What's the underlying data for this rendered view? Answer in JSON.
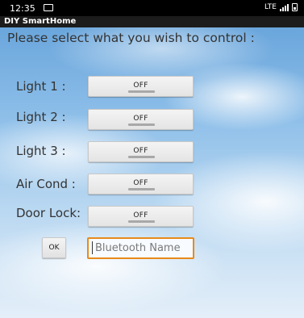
{
  "status_bar": {
    "time": "12:35",
    "network": "LTE"
  },
  "app": {
    "title": "DIY SmartHome"
  },
  "prompt": "Please select what you wish to control :",
  "controls": [
    {
      "label": "Light 1 :",
      "state": "OFF"
    },
    {
      "label": "Light 2 :",
      "state": "OFF"
    },
    {
      "label": "Light 3 :",
      "state": "OFF"
    },
    {
      "label": "Air Cond :",
      "state": "OFF"
    },
    {
      "label": "Door Lock:",
      "state": "OFF"
    }
  ],
  "ok_label": "OK",
  "bluetooth": {
    "placeholder": "Bluetooth Name",
    "value": ""
  },
  "colors": {
    "input_focus_border": "#e88a1a"
  }
}
